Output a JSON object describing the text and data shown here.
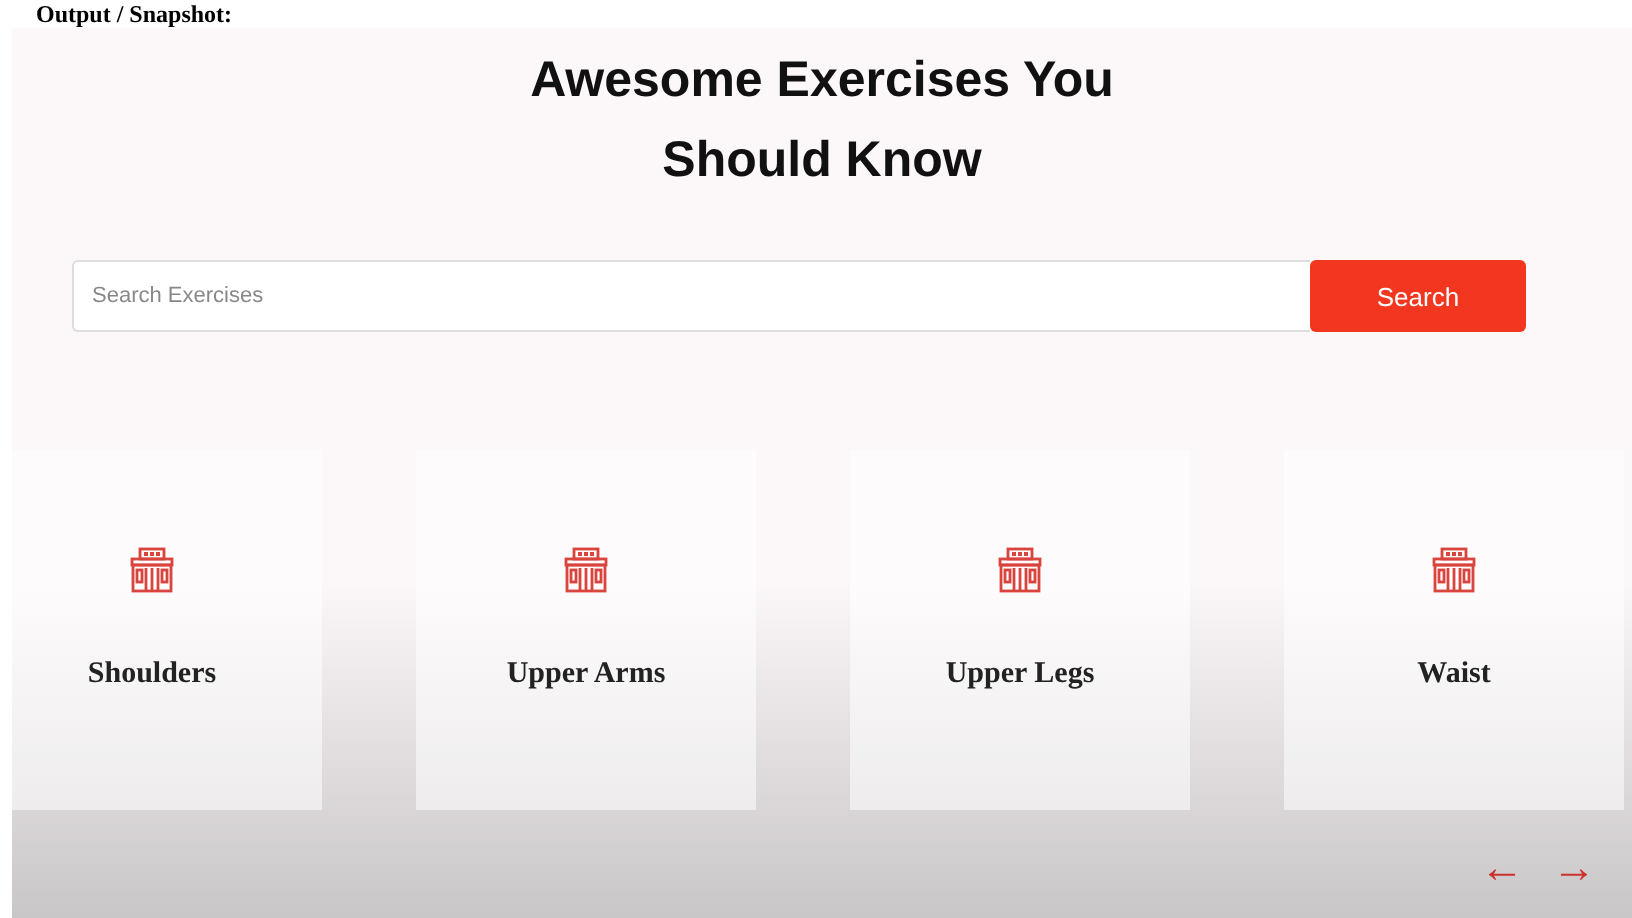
{
  "heading": "Output / Snapshot:",
  "title": "Awesome Exercises You Should Know",
  "search": {
    "placeholder": "Search Exercises",
    "button": "Search"
  },
  "categories": [
    {
      "label": "Shoulders"
    },
    {
      "label": "Upper Arms"
    },
    {
      "label": "Upper Legs"
    },
    {
      "label": "Waist"
    }
  ],
  "nav": {
    "prev": "←",
    "next": "→"
  }
}
